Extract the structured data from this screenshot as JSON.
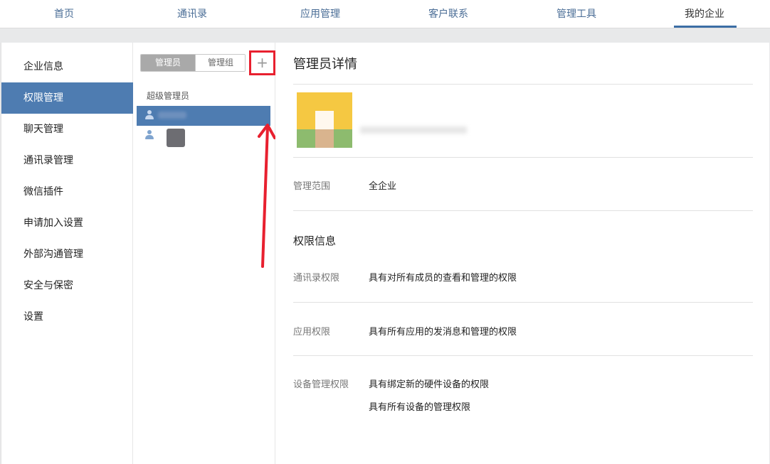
{
  "topnav": {
    "items": [
      {
        "label": "首页"
      },
      {
        "label": "通讯录"
      },
      {
        "label": "应用管理"
      },
      {
        "label": "客户联系"
      },
      {
        "label": "管理工具"
      },
      {
        "label": "我的企业"
      }
    ],
    "active": "我的企业"
  },
  "sidebar": {
    "items": [
      {
        "label": "企业信息"
      },
      {
        "label": "权限管理"
      },
      {
        "label": "聊天管理"
      },
      {
        "label": "通讯录管理"
      },
      {
        "label": "微信插件"
      },
      {
        "label": "申请加入设置"
      },
      {
        "label": "外部沟通管理"
      },
      {
        "label": "安全与保密"
      },
      {
        "label": "设置"
      }
    ],
    "active": "权限管理"
  },
  "listcol": {
    "tabs": [
      {
        "label": "管理员"
      },
      {
        "label": "管理组"
      }
    ],
    "add_symbol": "+",
    "group_label": "超级管理员"
  },
  "detail": {
    "title": "管理员详情",
    "scope_label": "管理范围",
    "scope_value": "全企业",
    "perm_title": "权限信息",
    "perms": [
      {
        "label": "通讯录权限",
        "values": [
          "具有对所有成员的查看和管理的权限"
        ]
      },
      {
        "label": "应用权限",
        "values": [
          "具有所有应用的发消息和管理的权限"
        ]
      },
      {
        "label": "设备管理权限",
        "values": [
          "具有绑定新的硬件设备的权限",
          "具有所有设备的管理权限"
        ]
      }
    ]
  },
  "colors": {
    "accent": "#4e7cb1",
    "nav_link": "#4a6d96",
    "highlight": "#e8202f"
  }
}
